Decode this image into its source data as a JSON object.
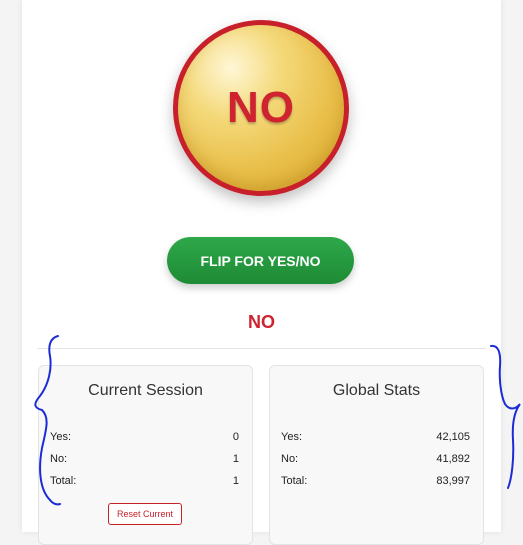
{
  "coin": {
    "face_text": "NO"
  },
  "flip_button": {
    "label": "FLIP FOR YES/NO"
  },
  "result": {
    "text": "NO"
  },
  "current_session": {
    "title": "Current Session",
    "rows": [
      {
        "label": "Yes:",
        "value": "0"
      },
      {
        "label": "No:",
        "value": "1"
      },
      {
        "label": "Total:",
        "value": "1"
      }
    ],
    "reset_label": "Reset Current"
  },
  "global_stats": {
    "title": "Global Stats",
    "rows": [
      {
        "label": "Yes:",
        "value": "42,105"
      },
      {
        "label": "No:",
        "value": "41,892"
      },
      {
        "label": "Total:",
        "value": "83,997"
      }
    ]
  },
  "colors": {
    "accent_red": "#cf2330",
    "button_green": "#1e8b35",
    "coin_gold": "#e9bf4a",
    "annotation_blue": "#1c2bd6"
  }
}
